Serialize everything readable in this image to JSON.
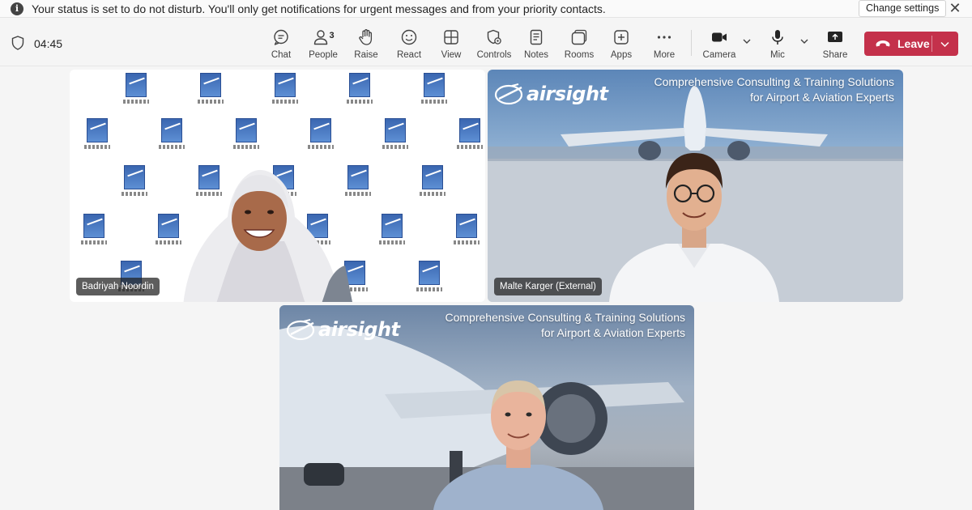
{
  "banner": {
    "message": "Your status is set to do not disturb. You'll only get notifications for urgent messages and from your priority contacts.",
    "change_settings": "Change settings",
    "icon": "info-icon",
    "close_icon": "close-icon"
  },
  "toolbar": {
    "timer": "04:45",
    "chat": "Chat",
    "people": "People",
    "people_count": "3",
    "raise": "Raise",
    "react": "React",
    "view": "View",
    "controls": "Controls",
    "notes": "Notes",
    "rooms": "Rooms",
    "apps": "Apps",
    "more": "More",
    "camera": "Camera",
    "mic": "Mic",
    "share": "Share",
    "leave": "Leave"
  },
  "participants": [
    {
      "name": "Badriyah Noordin"
    },
    {
      "name": "Malte Karger (External)"
    },
    {
      "name": ""
    }
  ],
  "airsight": {
    "brand": "airsight",
    "tagline_1": "Comprehensive Consulting & Training Solutions",
    "tagline_2": "for Airport & Aviation Experts"
  },
  "colors": {
    "leave_button": "#c4314b",
    "toolbar_bg": "#f5f5f5"
  }
}
